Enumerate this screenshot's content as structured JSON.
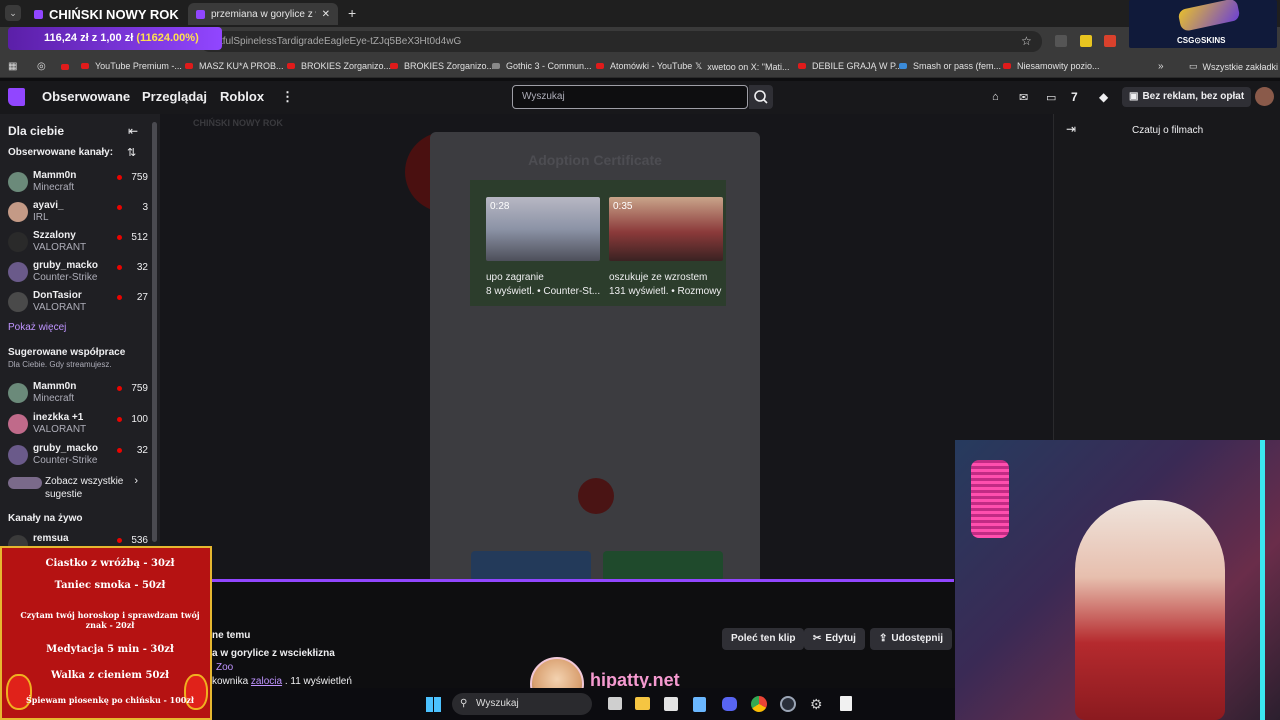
{
  "browser": {
    "tab_1_title": "CHIŃSKI NOWY ROK",
    "tab_2_title": "przemiana w gorylice z wsciekl",
    "new_tab": "+",
    "url": "tfulSpinelessTardigradeEagleEye-tZJq5BeX3Ht0d4wG",
    "bookmarks": [
      "YouTube Premium -...",
      "MASZ KU*A PROB...",
      "BROKIES Zorganizo...",
      "BROKIES Zorganizo...",
      "Gothic 3 - Commun...",
      "Atomówki - YouTube",
      "xwetoo on X: \"Mati...",
      "DEBILE GRAJĄ W P...",
      "Smash or pass (fem...",
      "Niesamowity pozio..."
    ],
    "all_bookmarks": "Wszystkie zakładki"
  },
  "donation_bar": {
    "text": "116,24 zł z 1,00 zł",
    "percent": "(11624.00%)"
  },
  "csgo_skins": {
    "label": "CSG⊙SKINS"
  },
  "twitch_nav": {
    "followed": "Obserwowane",
    "browse": "Przeglądaj",
    "roblox": "Roblox",
    "more": "⋮",
    "search_placeholder": "Wyszukaj",
    "ads_label": "Bez reklam, bez opłat"
  },
  "sidebar": {
    "for_you": "Dla ciebie",
    "followed_channels": "Obserwowane kanały:",
    "followed": [
      {
        "name": "Mamm0n",
        "game": "Minecraft",
        "viewers": "759"
      },
      {
        "name": "ayavi_",
        "game": "IRL",
        "viewers": "3"
      },
      {
        "name": "Szzalony",
        "game": "VALORANT",
        "viewers": "512"
      },
      {
        "name": "gruby_macko",
        "game": "Counter-Strike",
        "viewers": "32"
      },
      {
        "name": "DonTasior",
        "game": "VALORANT",
        "viewers": "27"
      }
    ],
    "show_more": "Pokaż więcej",
    "suggested_title": "Sugerowane współprace",
    "suggested_sub": "Dla Ciebie. Gdy streamujesz.",
    "suggested": [
      {
        "name": "Mamm0n",
        "game": "Minecraft",
        "viewers": "759"
      },
      {
        "name": "inezkka +1",
        "game": "VALORANT",
        "viewers": "100"
      },
      {
        "name": "gruby_macko",
        "game": "Counter-Strike",
        "viewers": "32"
      }
    ],
    "see_all": "Zobacz wszystkie sugestie",
    "live_title": "Kanały na żywo",
    "live": [
      {
        "name": "remsua",
        "viewers": "536"
      }
    ]
  },
  "main": {
    "overlay_title": "CHIŃSKI NOWY ROK",
    "certificate_title": "Adoption Certificate",
    "clips": [
      {
        "duration": "0:28",
        "title": "upo zagranie",
        "meta": "8 wyświetl. • Counter-St..."
      },
      {
        "duration": "0:35",
        "title": "oszukuje ze wzrostem",
        "meta": "131 wyświetl. • Rozmowy"
      }
    ]
  },
  "info": {
    "topic_frag": "ne temu",
    "title_frag": "a w gorylice z wsciekłizna",
    "category_frag": "Zoo",
    "clipper_prefix": "kownika",
    "clipper": "zalocia",
    "views": ". 11 wyświetleń",
    "recommend": "Poleć ten klip",
    "edit": "Edytuj",
    "share": "Udostępnij"
  },
  "chat": {
    "title": "Czatuj o filmach"
  },
  "overlay_menu": [
    "Ciastko z wróżbą - 30zł",
    "Taniec smoka - 50zł",
    "Czytam twój horoskop i sprawdzam twój znak - 20zł",
    "Medytacja 5 min - 30zł",
    "Walka z cieniem 50zł",
    "Śpiewam piosenkę po chińsku - 100zł"
  ],
  "watermark": "hipatty.net",
  "taskbar": {
    "search": "Wyszukaj"
  },
  "colors": {
    "twitch_purple": "#9146ff",
    "live_red": "#eb0400",
    "menu_red": "#b51212",
    "menu_gold": "#e6b730"
  }
}
